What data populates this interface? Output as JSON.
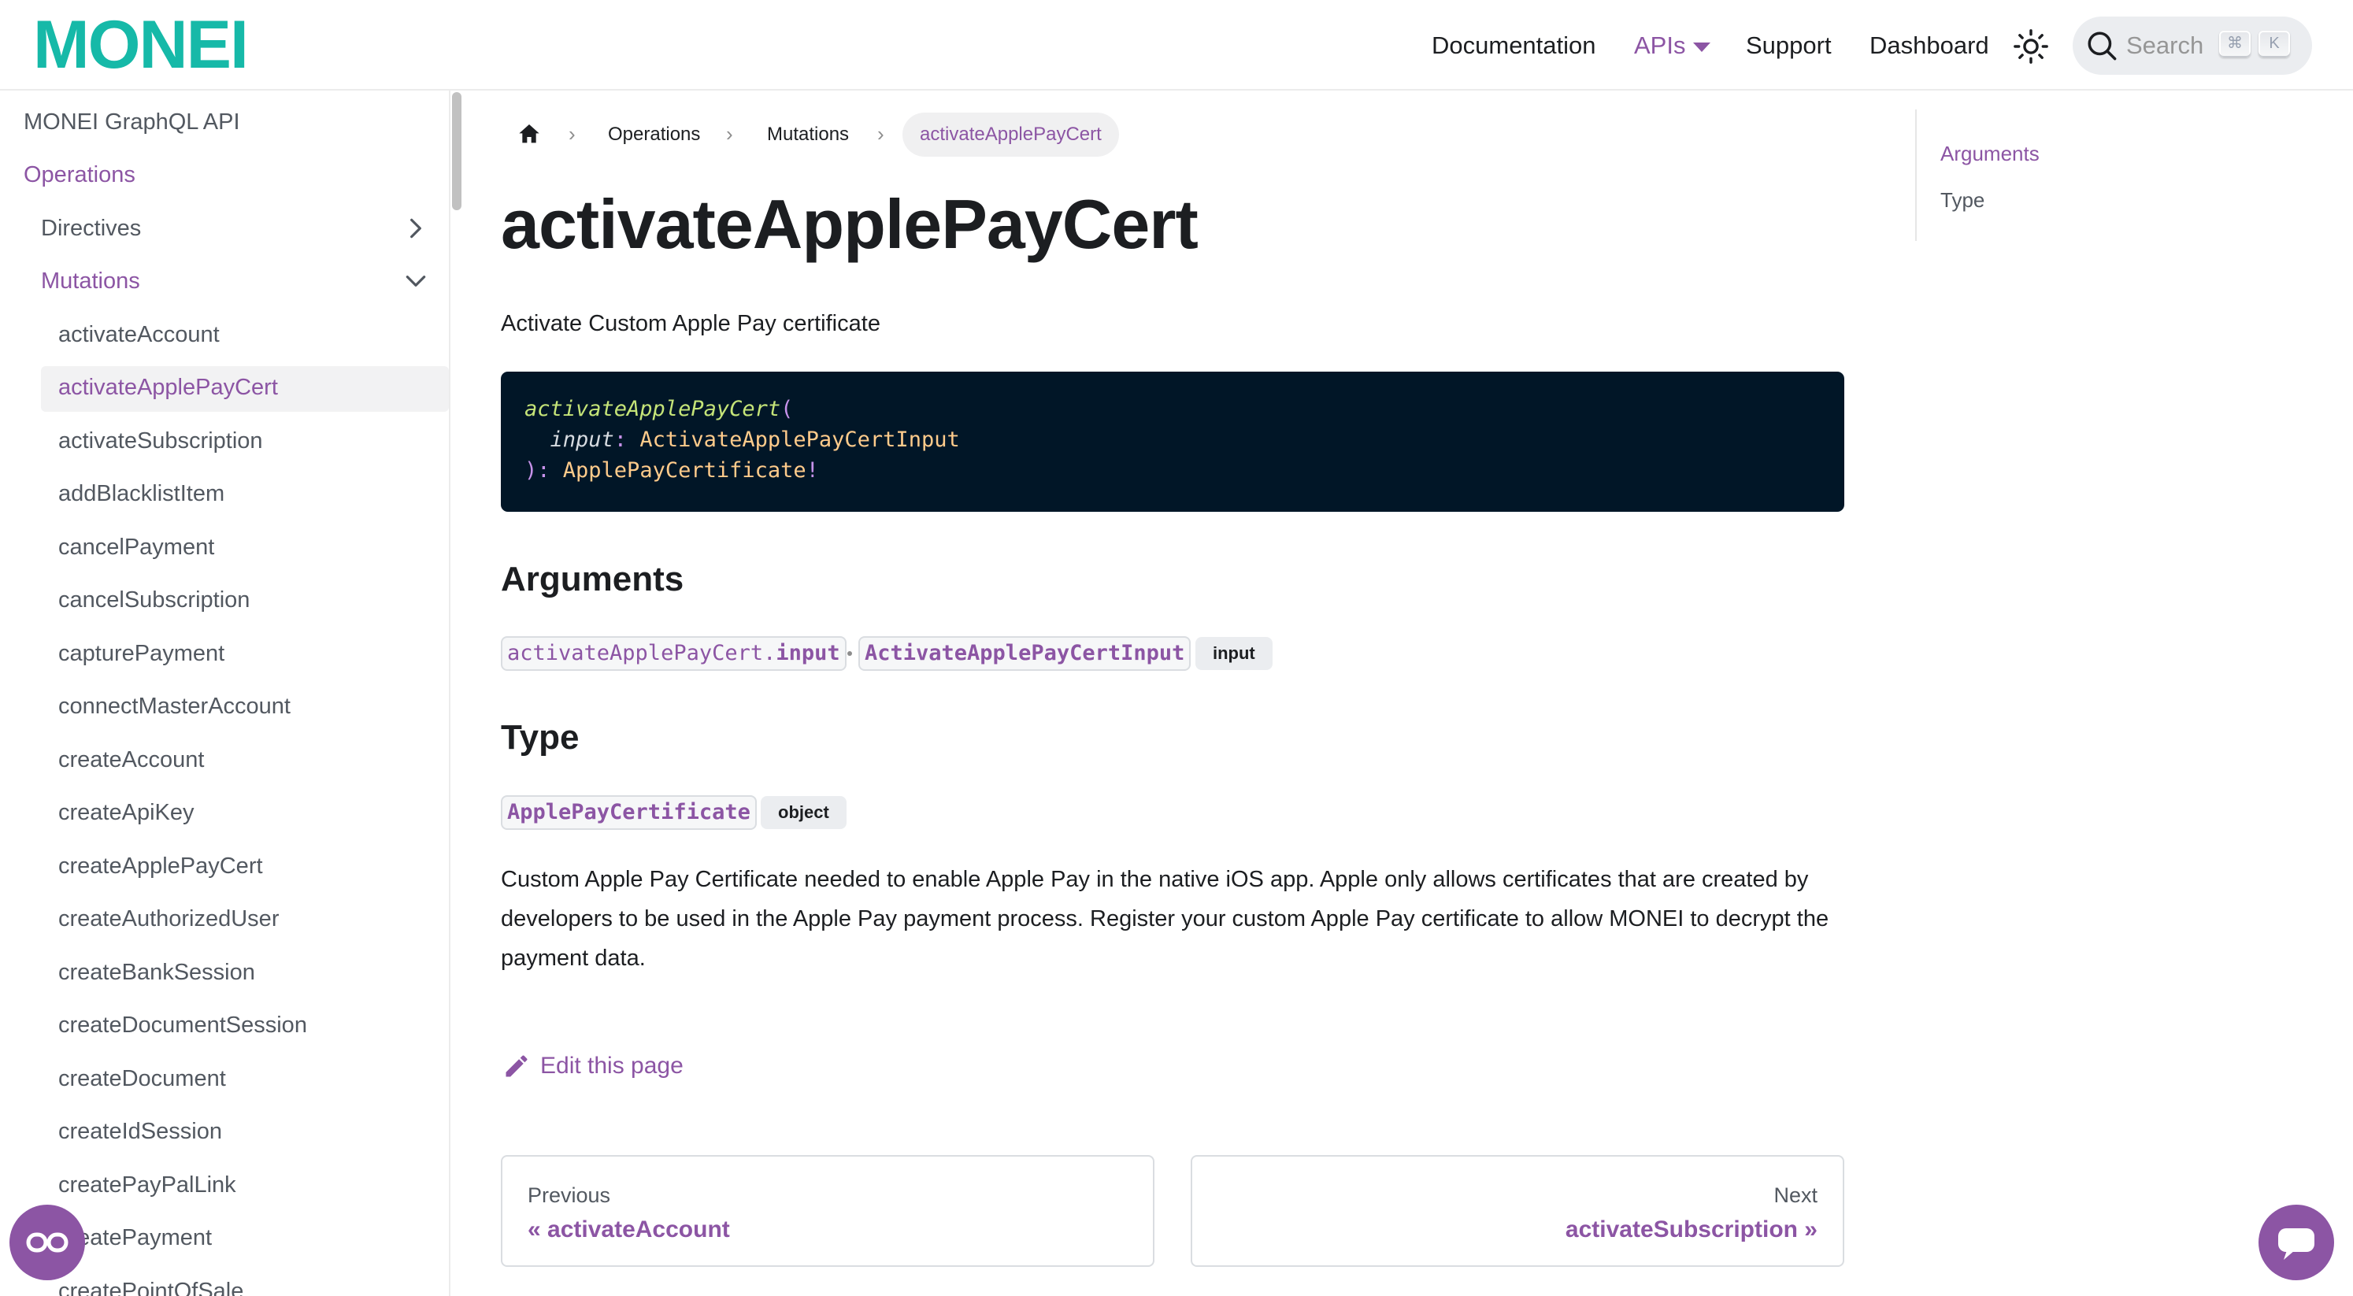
{
  "brand": {
    "logo": "MONEI",
    "accent": "#8c55a4",
    "logo_color": "#16b9a8"
  },
  "nav": {
    "documentation": "Documentation",
    "apis": "APIs",
    "support": "Support",
    "dashboard": "Dashboard",
    "search_placeholder": "Search",
    "kbd_cmd": "⌘",
    "kbd_k": "K"
  },
  "sidebar": {
    "root": "MONEI GraphQL API",
    "operations": "Operations",
    "directives": "Directives",
    "mutations": "Mutations",
    "items": [
      "activateAccount",
      "activateApplePayCert",
      "activateSubscription",
      "addBlacklistItem",
      "cancelPayment",
      "cancelSubscription",
      "capturePayment",
      "connectMasterAccount",
      "createAccount",
      "createApiKey",
      "createApplePayCert",
      "createAuthorizedUser",
      "createBankSession",
      "createDocumentSession",
      "createDocument",
      "createIdSession",
      "createPayPalLink",
      "createPayment",
      "createPointOfSale"
    ]
  },
  "breadcrumb": {
    "operations": "Operations",
    "mutations": "Mutations",
    "current": "activateApplePayCert"
  },
  "page": {
    "title": "activateApplePayCert",
    "description": "Activate Custom Apple Pay certificate",
    "code": {
      "fn": "activateApplePayCert",
      "open": "(",
      "arg": "input",
      "colon": ":",
      "arg_type": "ActivateApplePayCertInput",
      "close": "):",
      "return_type": "ApplePayCertificate",
      "bang": "!"
    },
    "arguments_heading": "Arguments",
    "argument": {
      "path_prefix": "activateApplePayCert.",
      "path_name": "input",
      "type": "ActivateApplePayCertInput",
      "badge": "input"
    },
    "type_heading": "Type",
    "type": {
      "name": "ApplePayCertificate",
      "badge": "object"
    },
    "type_description": "Custom Apple Pay Certificate needed to enable Apple Pay in the native iOS app. Apple only allows certificates that are created by developers to be used in the Apple Pay payment process. Register your custom Apple Pay certificate to allow MONEI to decrypt the payment data.",
    "edit_label": "Edit this page"
  },
  "pager": {
    "prev_sub": "Previous",
    "prev_title": "« activateAccount",
    "next_sub": "Next",
    "next_title": "activateSubscription »"
  },
  "toc": {
    "items": [
      "Arguments",
      "Type"
    ]
  },
  "icons": {
    "home": "home-icon",
    "theme": "sun-icon",
    "search": "search-icon",
    "edit": "pencil-icon",
    "chev_right": "chevron-right-icon",
    "chev_down": "chevron-down-icon",
    "ai_assistant": "glasses-icon",
    "chat": "chat-bubble-icon"
  }
}
